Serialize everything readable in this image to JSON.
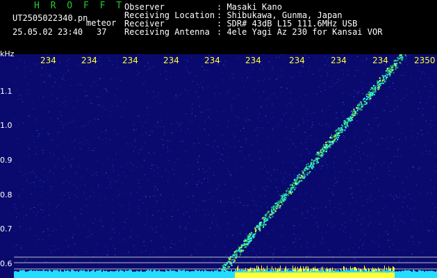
{
  "header": {
    "brand": "H R O F F T",
    "filename": "UT2505022340.pn",
    "tag": "meteor",
    "timestamp": "25.05.02 23:40",
    "count": "37",
    "info": [
      {
        "key": "Observer",
        "value": ": Masaki Kano"
      },
      {
        "key": "Receiving Location",
        "value": ": Shibukawa, Gunma, Japan"
      },
      {
        "key": "Receiver",
        "value": ": SDR# 43dB L15 111.6MHz USB"
      },
      {
        "key": "Receiving Antenna",
        "value": ": 4ele Yagi Az 230 for Kansai VOR"
      }
    ]
  },
  "chart_data": {
    "type": "heatmap",
    "yunit": "kHz",
    "yticks": [
      "1.1",
      "1.0",
      "0.9",
      "0.8",
      "0.7",
      "0.6"
    ],
    "xticks": [
      "234",
      "234",
      "234",
      "234",
      "234",
      "234",
      "234",
      "234",
      "234",
      "2350"
    ],
    "colors": {
      "background": "#0a0a6e",
      "noise": "#3355ff",
      "trail": "#33ffdd",
      "peak": "#ffff33",
      "baseline": "#22ddff",
      "tick": "#ffff33"
    }
  }
}
